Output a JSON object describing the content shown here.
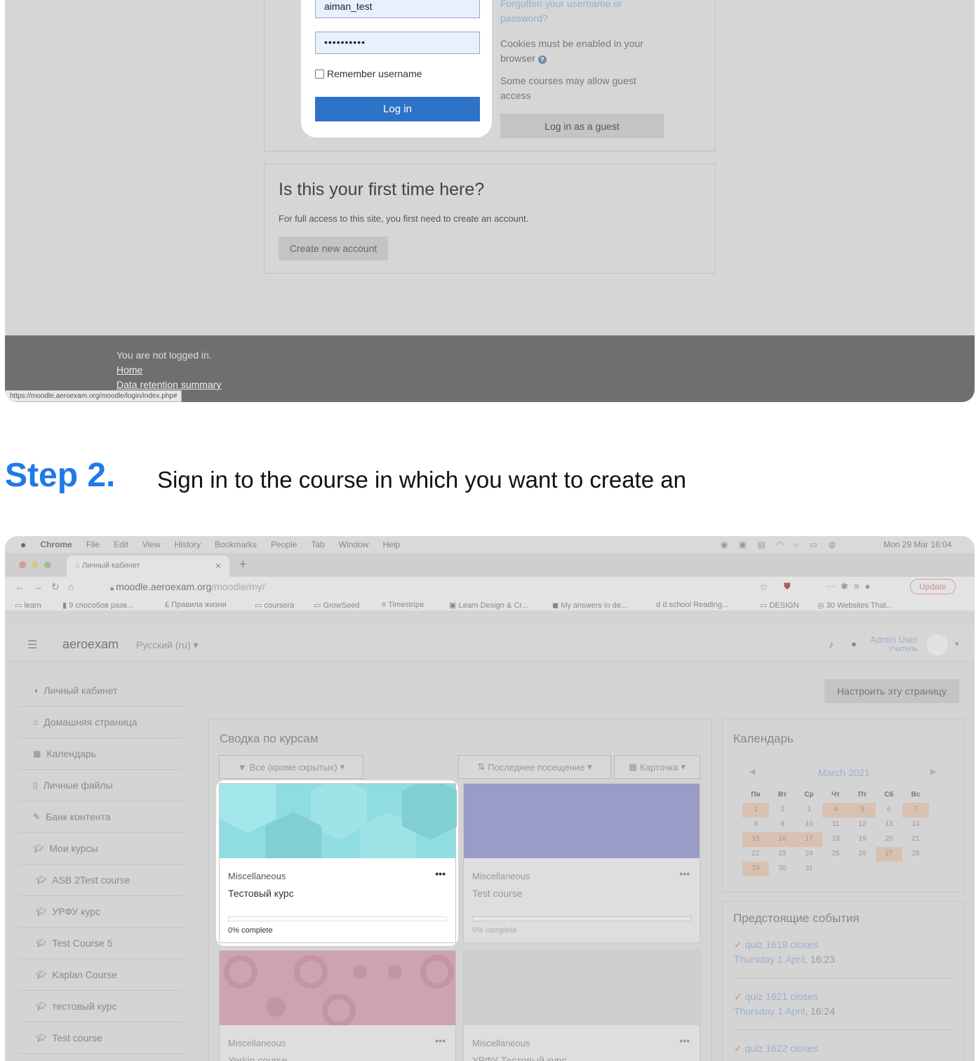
{
  "login_screen": {
    "username_value": "aiman_test",
    "password_value": "••••••••••",
    "remember_label": "Remember username",
    "login_button": "Log in",
    "forgot_line1": "Forgotten your username or",
    "forgot_line2": "password?",
    "cookies_line1": "Cookies must be enabled in your",
    "cookies_line2": "browser",
    "guest_line1": "Some courses may allow guest",
    "guest_line2": "access",
    "guest_button": "Log in as a guest",
    "first_time_heading": "Is this your first time here?",
    "first_time_text": "For full access to this site, you first need to create an account.",
    "create_button": "Create new account",
    "footer_not_logged": "You are not logged in.",
    "footer_home": "Home",
    "footer_data": "Data retention summary",
    "status_url": "https://moodle.aeroexam.org/moodle/login/index.php#"
  },
  "step": {
    "title": "Step 2.",
    "description": "Sign in to the course in which you want to create an"
  },
  "mac_menu": {
    "items": [
      "Chrome",
      "File",
      "Edit",
      "View",
      "History",
      "Bookmarks",
      "People",
      "Tab",
      "Window",
      "Help"
    ],
    "clock": "Mon 29 Mar  16:04"
  },
  "browser": {
    "tab_title": "Личный кабинет",
    "url_host": "moodle.aeroexam.org",
    "url_path": "/moodle/my/",
    "update_label": "Update",
    "bookmarks": [
      "learn",
      "9 способов разв...",
      "Правила жизни",
      "coursera",
      "GrowSeed",
      "Timestripe",
      "Learn Design & Cr...",
      "My answers in de...",
      "d.school Reading...",
      "DESIGN",
      "30 Websites That..."
    ]
  },
  "moodle": {
    "site_name": "aeroexam",
    "language": "Русский (ru)",
    "user_name": "Admin User",
    "user_role": "Учитель",
    "customize_button": "Настроить эту страницу",
    "nav": [
      "Личный кабинет",
      "Домашняя страница",
      "Календарь",
      "Личные файлы",
      "Банк контента",
      "Мои курсы"
    ],
    "courses_nav": [
      "ASB 2Test course",
      "УРФУ курс",
      "Test Course 5",
      "Kaplan Course",
      "тестовый курс",
      "Test course"
    ],
    "overview_title": "Сводка по курсам",
    "filter_all": "Все (кроме скрытых)",
    "sort_last": "Последнее посещение",
    "view_card": "Карточка",
    "courses": [
      {
        "category": "Miscellaneous",
        "name": "Тестовый курс",
        "progress": "0% complete"
      },
      {
        "category": "Miscellaneous",
        "name": "Test course",
        "progress": "0% complete"
      },
      {
        "category": "Miscellaneous",
        "name": "Yerkin course"
      },
      {
        "category": "Miscellaneous",
        "name": "УРФУ Тестовый курс"
      }
    ],
    "calendar_title": "Календарь",
    "calendar_month": "March 2021",
    "weekdays": [
      "Пн",
      "Вт",
      "Ср",
      "Чт",
      "Пт",
      "Сб",
      "Вс"
    ],
    "events_title": "Предстоящие события",
    "events": [
      {
        "name": "quiz 1619 closes",
        "date": "Thursday 1 April",
        "time": ", 16:23"
      },
      {
        "name": "quiz 1621 closes",
        "date": "Thursday 1 April",
        "time": ", 16:24"
      },
      {
        "name": "quiz 1622 closes"
      }
    ]
  }
}
